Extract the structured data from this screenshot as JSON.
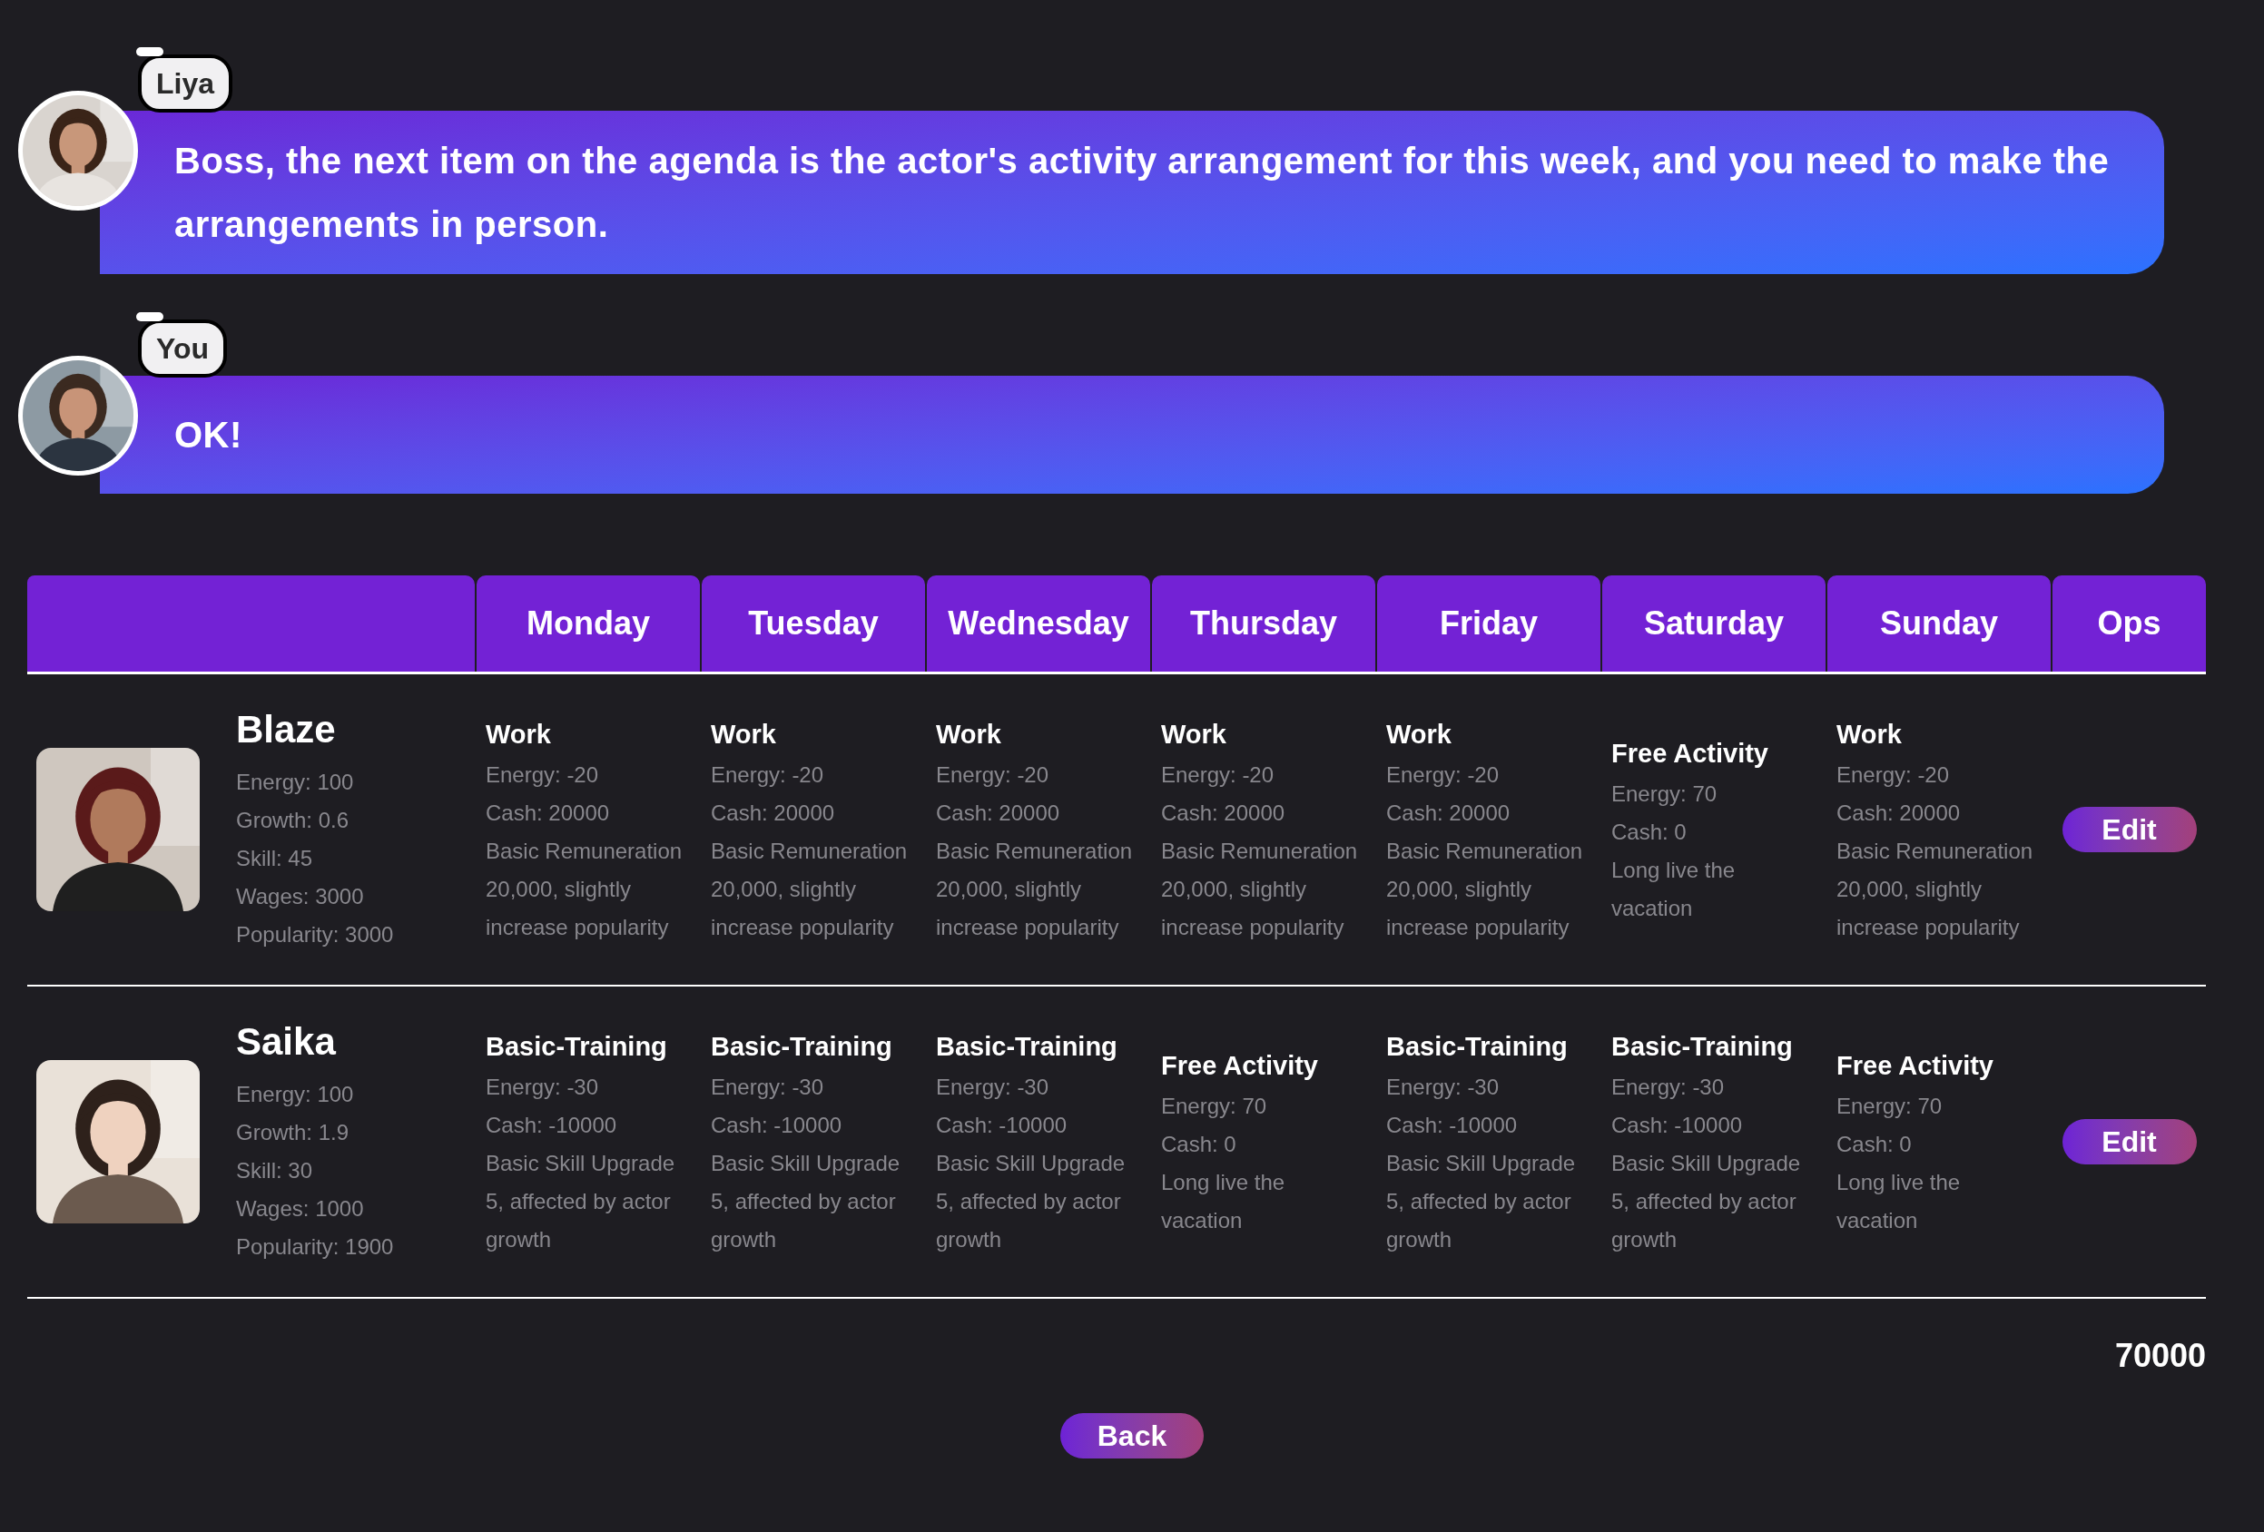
{
  "messages": [
    {
      "speaker": "Liya",
      "text": "Boss, the next item on the agenda is the actor's activity arrangement for this week, and you need to make the arrangements in person."
    },
    {
      "speaker": "You",
      "text": "OK!"
    }
  ],
  "schedule": {
    "columns": [
      "Monday",
      "Tuesday",
      "Wednesday",
      "Thursday",
      "Friday",
      "Saturday",
      "Sunday",
      "Ops"
    ],
    "rows": [
      {
        "name": "Blaze",
        "stats": [
          "Energy: 100",
          "Growth: 0.6",
          "Skill: 45",
          "Wages: 3000",
          "Popularity: 3000"
        ],
        "action": "Edit",
        "days": [
          {
            "title": "Work",
            "details": [
              "Energy: -20",
              "Cash: 20000",
              "Basic Remuneration 20,000, slightly increase popularity"
            ]
          },
          {
            "title": "Work",
            "details": [
              "Energy: -20",
              "Cash: 20000",
              "Basic Remuneration 20,000, slightly increase popularity"
            ]
          },
          {
            "title": "Work",
            "details": [
              "Energy: -20",
              "Cash: 20000",
              "Basic Remuneration 20,000, slightly increase popularity"
            ]
          },
          {
            "title": "Work",
            "details": [
              "Energy: -20",
              "Cash: 20000",
              "Basic Remuneration 20,000, slightly increase popularity"
            ]
          },
          {
            "title": "Work",
            "details": [
              "Energy: -20",
              "Cash: 20000",
              "Basic Remuneration 20,000, slightly increase popularity"
            ]
          },
          {
            "title": "Free Activity",
            "details": [
              "Energy: 70",
              "Cash: 0",
              "Long live the vacation"
            ]
          },
          {
            "title": "Work",
            "details": [
              "Energy: -20",
              "Cash: 20000",
              "Basic Remuneration 20,000, slightly increase popularity"
            ]
          }
        ]
      },
      {
        "name": "Saika",
        "stats": [
          "Energy: 100",
          "Growth: 1.9",
          "Skill: 30",
          "Wages: 1000",
          "Popularity: 1900"
        ],
        "action": "Edit",
        "days": [
          {
            "title": "Basic-Training",
            "details": [
              "Energy: -30",
              "Cash: -10000",
              "Basic Skill Upgrade 5, affected by actor growth"
            ]
          },
          {
            "title": "Basic-Training",
            "details": [
              "Energy: -30",
              "Cash: -10000",
              "Basic Skill Upgrade 5, affected by actor growth"
            ]
          },
          {
            "title": "Basic-Training",
            "details": [
              "Energy: -30",
              "Cash: -10000",
              "Basic Skill Upgrade 5, affected by actor growth"
            ]
          },
          {
            "title": "Free Activity",
            "details": [
              "Energy: 70",
              "Cash: 0",
              "Long live the vacation"
            ]
          },
          {
            "title": "Basic-Training",
            "details": [
              "Energy: -30",
              "Cash: -10000",
              "Basic Skill Upgrade 5, affected by actor growth"
            ]
          },
          {
            "title": "Basic-Training",
            "details": [
              "Energy: -30",
              "Cash: -10000",
              "Basic Skill Upgrade 5, affected by actor growth"
            ]
          },
          {
            "title": "Free Activity",
            "details": [
              "Energy: 70",
              "Cash: 0",
              "Long live the vacation"
            ]
          }
        ]
      }
    ]
  },
  "total": "70000",
  "back_button": "Back"
}
